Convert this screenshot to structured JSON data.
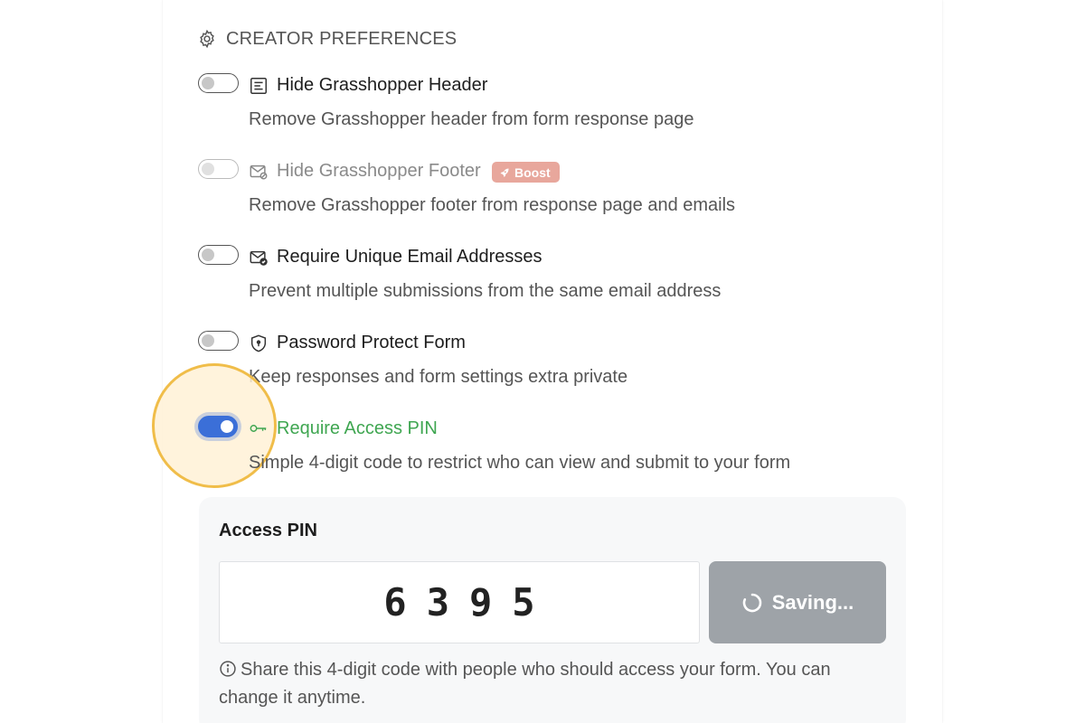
{
  "section": {
    "title": "CREATOR PREFERENCES",
    "icon": "gear-icon"
  },
  "options": [
    {
      "title": "Hide Grasshopper Header",
      "description": "Remove Grasshopper header from form response page",
      "icon": "document-icon",
      "enabled": false,
      "disabled": false
    },
    {
      "title": "Hide Grasshopper Footer",
      "description": "Remove Grasshopper footer from response page and emails",
      "icon": "mail-off-icon",
      "enabled": false,
      "disabled": true,
      "badge": "Boost",
      "badge_icon": "rocket-icon"
    },
    {
      "title": "Require Unique Email Addresses",
      "description": "Prevent multiple submissions from the same email address",
      "icon": "mail-check-icon",
      "enabled": false,
      "disabled": false
    },
    {
      "title": "Password Protect Form",
      "description": "Keep responses and form settings extra private",
      "icon": "shield-lock-icon",
      "enabled": false,
      "disabled": false
    },
    {
      "title": "Require Access PIN",
      "description": "Simple 4-digit code to restrict who can view and submit to your form",
      "icon": "key-icon",
      "enabled": true,
      "disabled": false
    }
  ],
  "pin": {
    "label": "Access PIN",
    "value": "6395",
    "save_label": "Saving...",
    "hint": "Share this 4-digit code with people who should access your form. You can change it anytime."
  },
  "colors": {
    "accent": "#3b6fd8",
    "success": "#3fa651",
    "badge": "#e8a79c",
    "highlight_ring": "#f0bd49",
    "button_disabled": "#9ea3a8"
  }
}
